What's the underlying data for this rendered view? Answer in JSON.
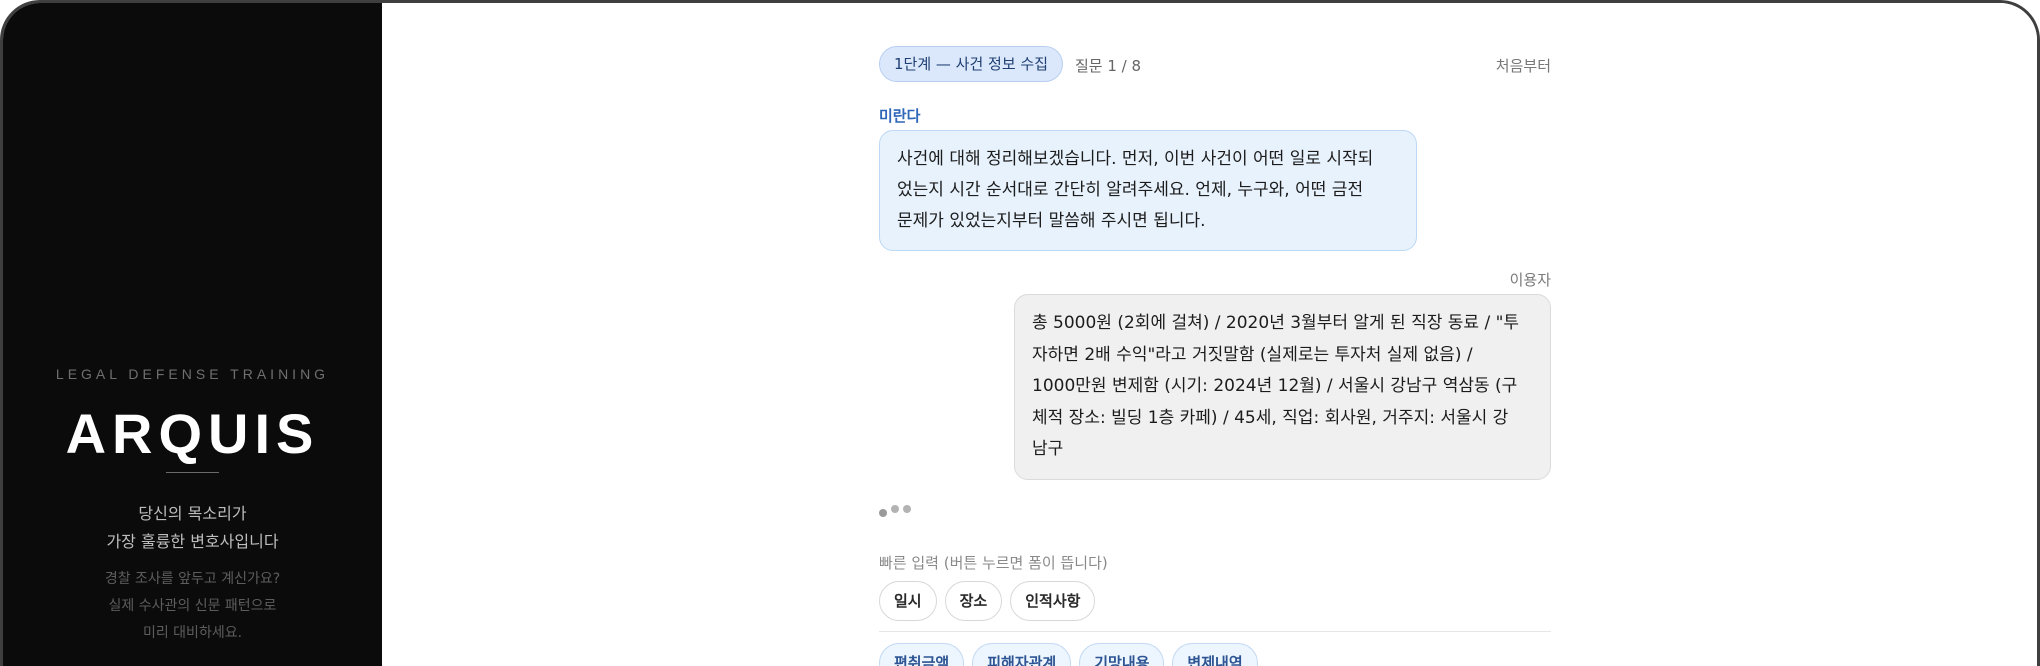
{
  "sidebar": {
    "kicker": "LEGAL DEFENSE TRAINING",
    "logo": "ARQUIS",
    "tagline_line1": "당신의 목소리가",
    "tagline_line2": "가장 훌륭한 변호사입니다",
    "sub_line1": "경찰 조사를 앞두고 계신가요?",
    "sub_line2": "실제 수사관의 신문 패턴으로",
    "sub_line3": "미리 대비하세요."
  },
  "header": {
    "phase_label": "1단계 — 사건 정보 수집",
    "question_counter": "질문 1 / 8",
    "restart_label": "처음부터"
  },
  "messages": [
    {
      "sender": "미란다",
      "role": "assistant",
      "lines": [
        "사건에 대해 정리해보겠습니다. 먼저, 이번 사건이 어떤 일로 시작되",
        "었는지 시간 순서대로 간단히 알려주세요. 언제, 누구와, 어떤 금전",
        "문제가 있었는지부터 말씀해 주시면 됩니다."
      ]
    },
    {
      "sender": "이용자",
      "role": "user",
      "lines": [
        "총 5000원 (2회에 걸쳐) / 2020년 3월부터 알게 된 직장 동료 / \"투",
        "자하면 2배 수익\"라고 거짓말함 (실제로는 투자처 실제 없음) /",
        "1000만원 변제함 (시기: 2024년 12월) / 서울시 강남구 역삼동 (구",
        "체적 장소: 빌딩 1층 카페) / 45세, 직업: 회사원, 거주지: 서울시 강",
        "남구"
      ]
    }
  ],
  "quick_input": {
    "title": "빠른 입력 (버튼 누르면 폼이 뜹니다)",
    "group1": [
      "일시",
      "장소",
      "인적사항"
    ],
    "group2": [
      "편취금액",
      "피해자관계",
      "기망내용",
      "변제내역"
    ]
  },
  "colors": {
    "sidebar_bg": "#0b0b0b",
    "accent_blue": "#2f66b8",
    "ai_bubble_bg": "#e7f2fd",
    "user_bubble_bg": "#f0f0f0"
  }
}
